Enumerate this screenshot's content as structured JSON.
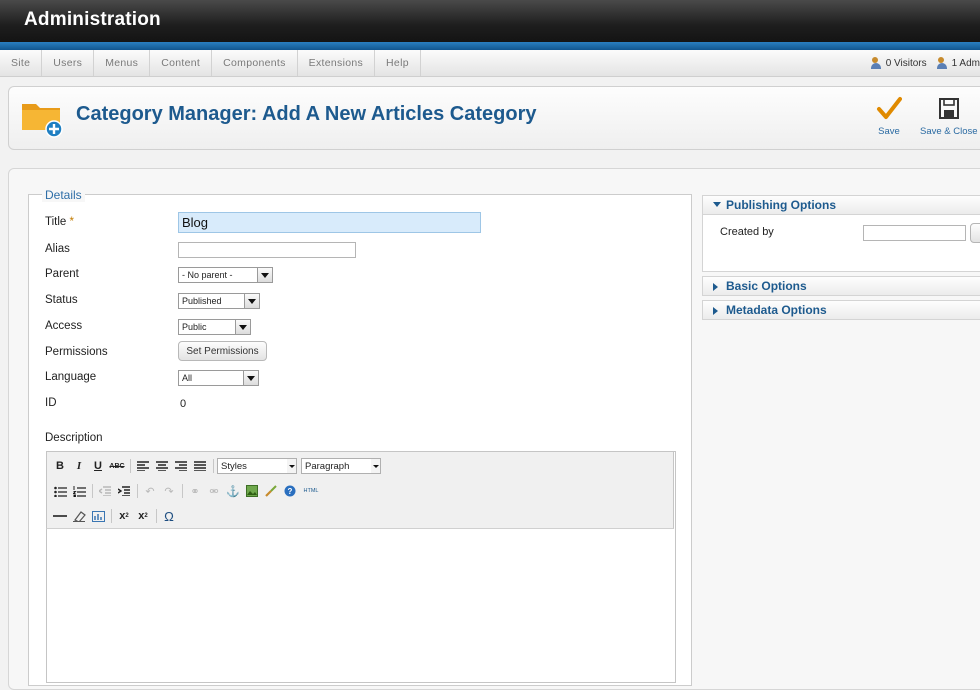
{
  "header": {
    "title": "Administration"
  },
  "menu": {
    "items": [
      "Site",
      "Users",
      "Menus",
      "Content",
      "Components",
      "Extensions",
      "Help"
    ]
  },
  "status": {
    "visitors": "0 Visitors",
    "admins": "1 Adm"
  },
  "toolbar": {
    "page_title": "Category Manager: Add A New Articles Category",
    "save_label": "Save",
    "save_close_label": "Save & Close"
  },
  "details": {
    "legend": "Details",
    "title_label": "Title",
    "required_mark": "*",
    "title_value": "Blog",
    "alias_label": "Alias",
    "alias_value": "",
    "parent_label": "Parent",
    "parent_value": "- No parent -",
    "status_label": "Status",
    "status_value": "Published",
    "access_label": "Access",
    "access_value": "Public",
    "permissions_label": "Permissions",
    "permissions_button": "Set Permissions",
    "language_label": "Language",
    "language_value": "All",
    "id_label": "ID",
    "id_value": "0",
    "description_label": "Description"
  },
  "editor": {
    "styles_value": "Styles",
    "format_value": "Paragraph",
    "html_label": "HTML"
  },
  "sidebar": {
    "publishing": {
      "title": "Publishing Options",
      "created_by_label": "Created by"
    },
    "basic": {
      "title": "Basic Options"
    },
    "metadata": {
      "title": "Metadata Options"
    }
  },
  "colors": {
    "accent": "#1d5a8e",
    "header_blue": "#2a7fc0",
    "save_check": "#e08a00"
  }
}
